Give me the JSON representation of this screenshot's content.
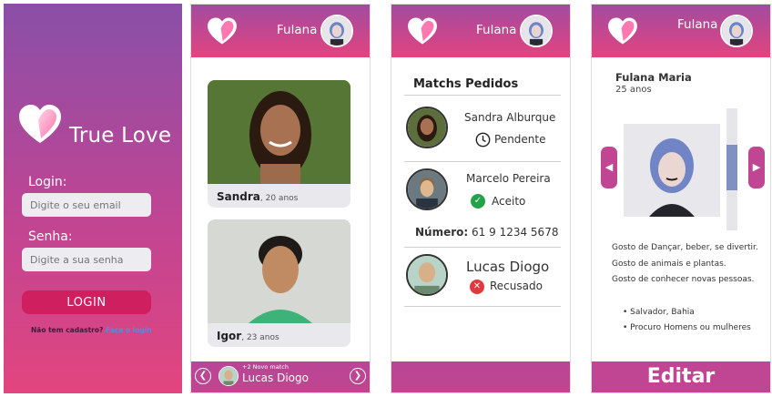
{
  "login_screen": {
    "brand": "True Love",
    "login_label": "Login:",
    "email_placeholder": "Digite o seu email",
    "password_label": "Senha:",
    "password_placeholder": "Digite a sua senha",
    "login_button": "LOGIN",
    "signup_prompt": "Não tem cadastro?",
    "signup_link": "Faça o login"
  },
  "user": {
    "name": "Fulana"
  },
  "swipe_screen": {
    "cards": [
      {
        "name": "Sandra",
        "age": ", 20 anos"
      },
      {
        "name": "Igor",
        "age": ", 23 anos"
      }
    ],
    "new_match_count": "+2 Novo match",
    "new_match_name": "Lucas Diogo"
  },
  "matches_screen": {
    "title": "Matchs Pedidos",
    "matches": [
      {
        "name": "Sandra Alburque",
        "status": "Pendente"
      },
      {
        "name": "Marcelo Pereira",
        "status": "Aceito"
      },
      {
        "name": "Lucas Diogo",
        "status": "Recusado"
      }
    ],
    "number_label": "Número:",
    "number_value": "61 9 1234 5678"
  },
  "profile_screen": {
    "full_name": "Fulana Maria",
    "age": "25 anos",
    "description": [
      "Gosto de Dançar, beber, se divertir.",
      "Gosto de animais e plantas.",
      "Gosto de conhecer novas pessoas."
    ],
    "details": [
      "Salvador, Bahia",
      "Procuro Homens ou mulheres"
    ],
    "edit_button": "Editar"
  },
  "colors": {
    "accent": "#c04593",
    "pink": "#e2447f",
    "purple": "#8a4fa8",
    "login_button": "#cf1f5e"
  },
  "icons": [
    "heart-logo-icon",
    "clock-icon",
    "check-icon",
    "close-icon",
    "chevron-left-icon",
    "chevron-right-icon"
  ]
}
